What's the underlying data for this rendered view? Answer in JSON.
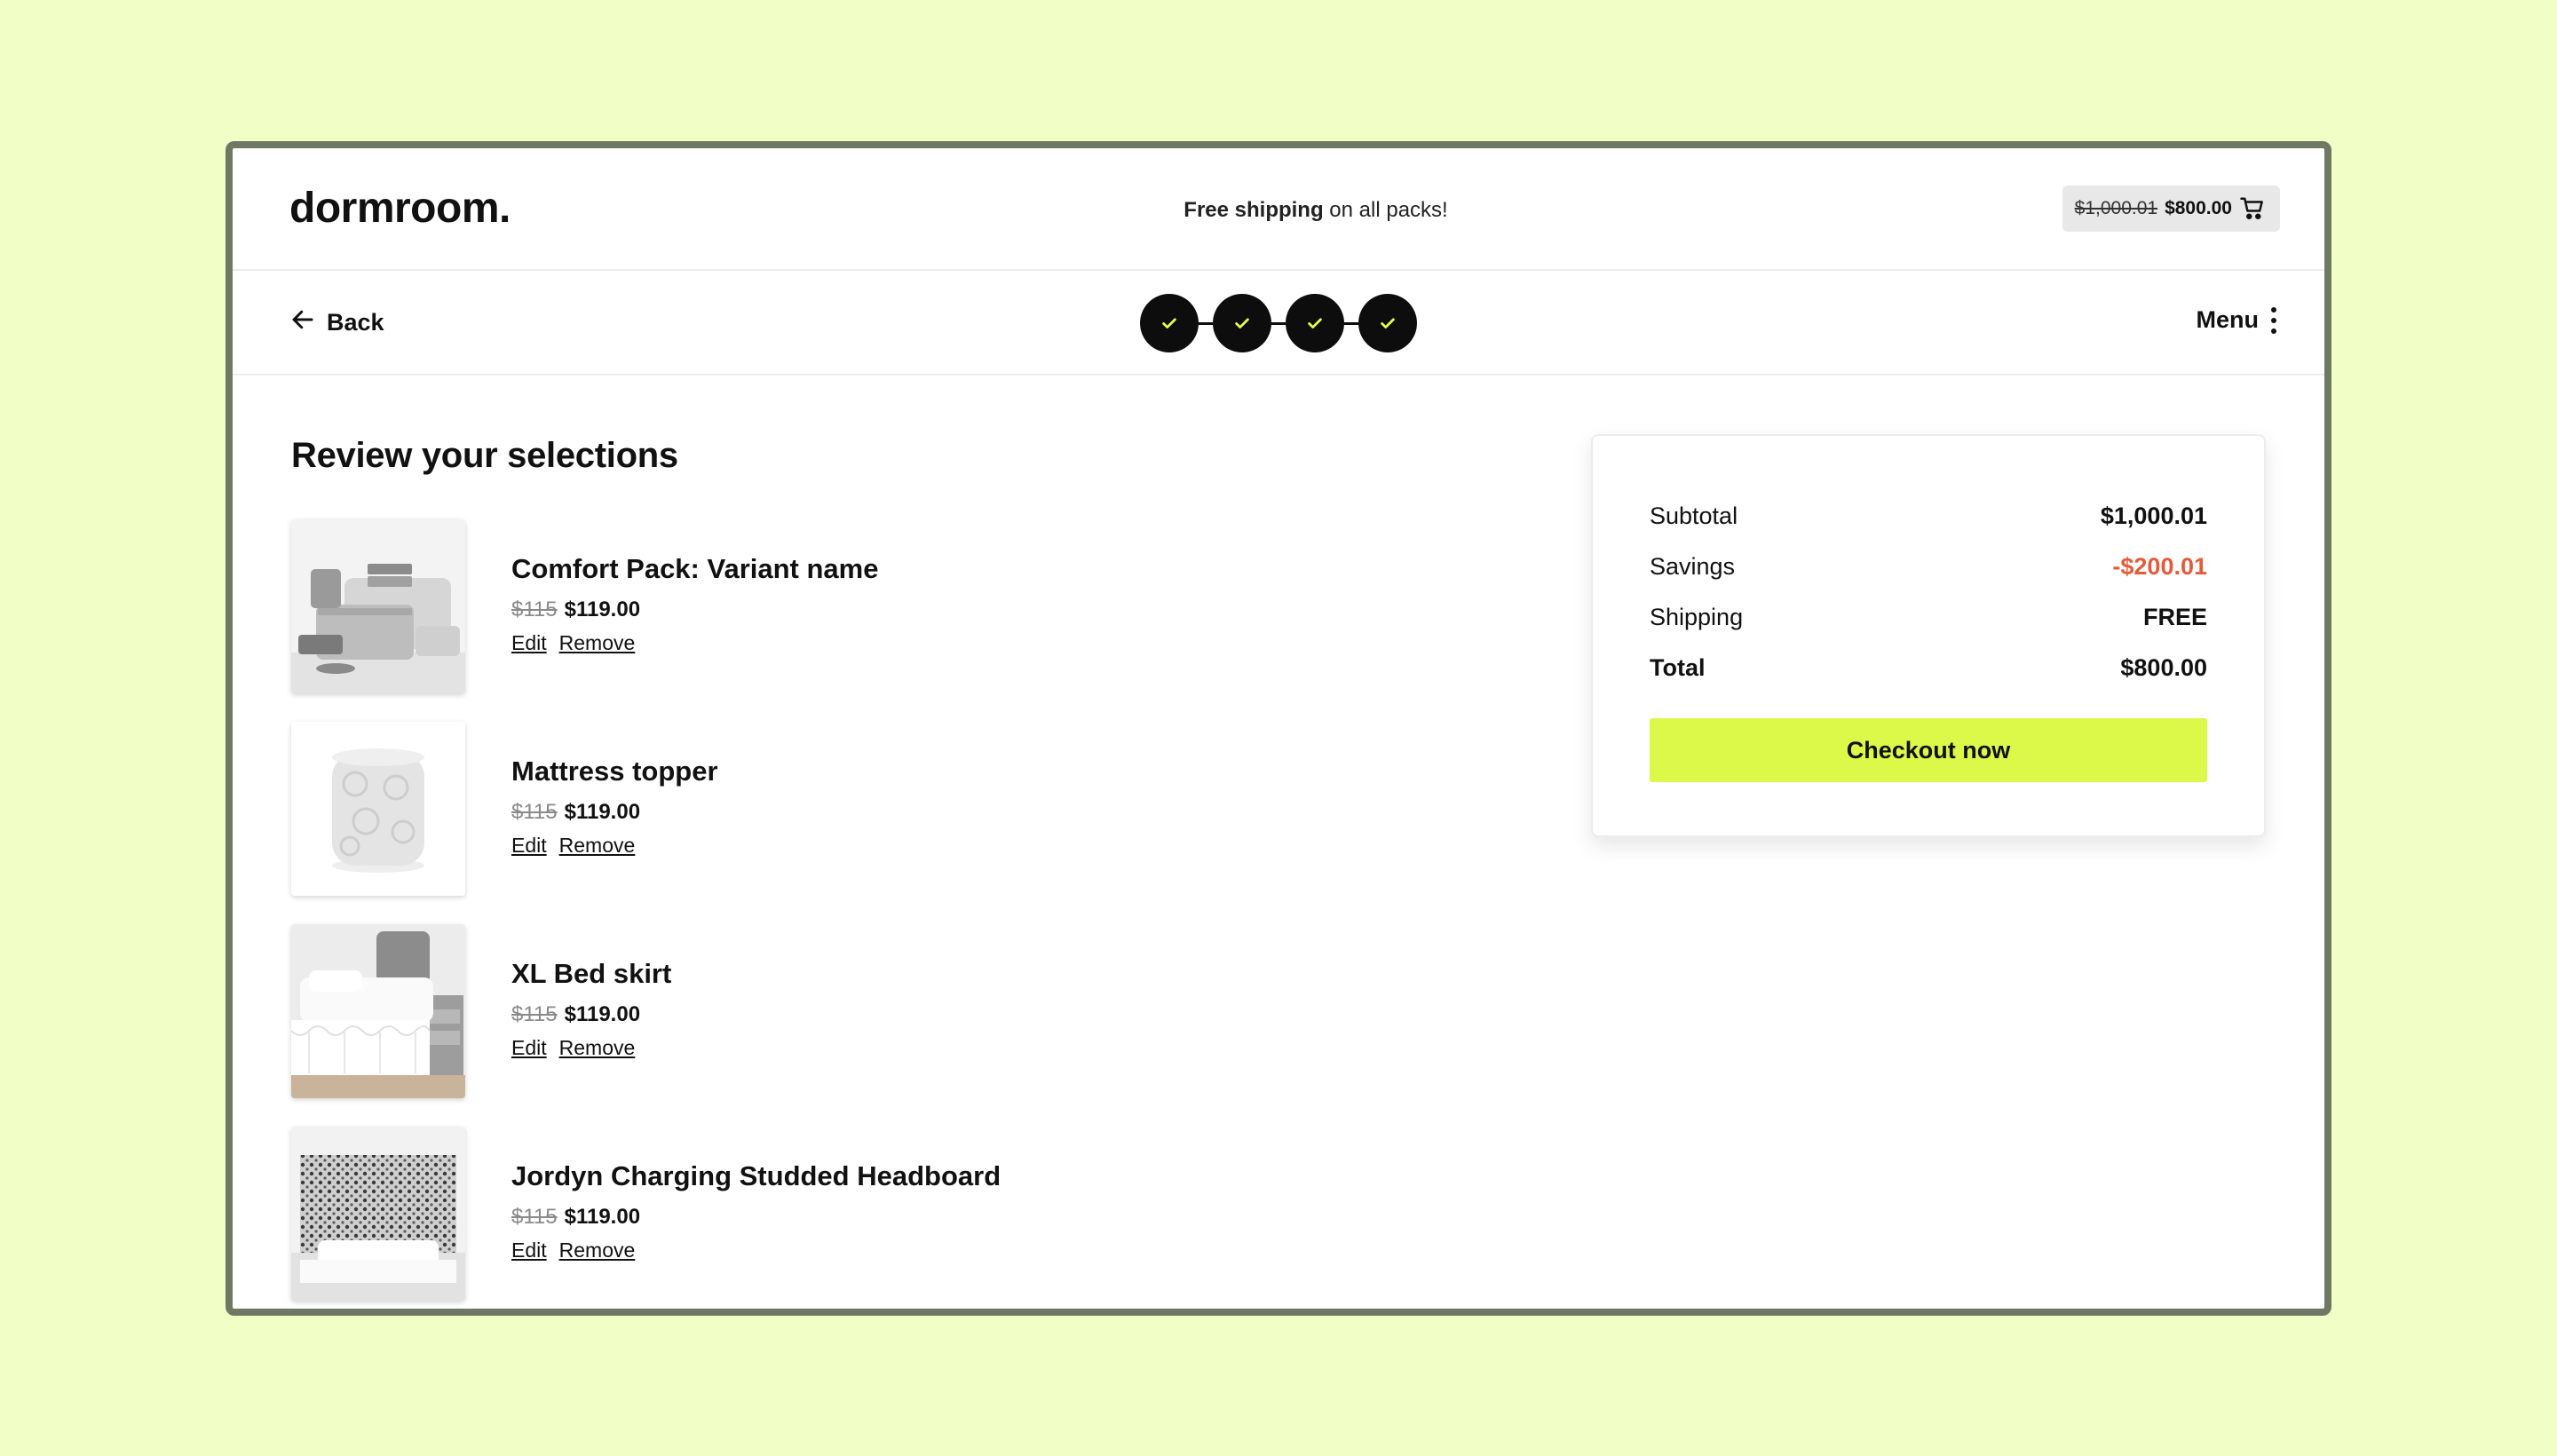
{
  "brand": {
    "logo": "dormroom."
  },
  "promo": {
    "bold": "Free shipping",
    "rest": " on all packs!"
  },
  "cart": {
    "original_total": "$1,000.01",
    "total": "$800.00",
    "icon": "cart-icon"
  },
  "nav": {
    "back_label": "Back",
    "menu_label": "Menu",
    "steps": [
      {
        "status": "complete",
        "icon": "check-icon"
      },
      {
        "status": "complete",
        "icon": "check-icon"
      },
      {
        "status": "complete",
        "icon": "check-icon"
      },
      {
        "status": "complete",
        "icon": "check-icon"
      }
    ]
  },
  "main": {
    "title": "Review your selections",
    "items": [
      {
        "name": "Comfort Pack: Variant name",
        "old_price": "$115",
        "price": "$119.00",
        "edit": "Edit",
        "remove": "Remove"
      },
      {
        "name": "Mattress topper",
        "old_price": "$115",
        "price": "$119.00",
        "edit": "Edit",
        "remove": "Remove"
      },
      {
        "name": "XL Bed skirt",
        "old_price": "$115",
        "price": "$119.00",
        "edit": "Edit",
        "remove": "Remove"
      },
      {
        "name": "Jordyn Charging Studded Headboard",
        "old_price": "$115",
        "price": "$119.00",
        "edit": "Edit",
        "remove": "Remove"
      }
    ]
  },
  "summary": {
    "subtotal_label": "Subtotal",
    "subtotal": "$1,000.01",
    "savings_label": "Savings",
    "savings": "-$200.01",
    "shipping_label": "Shipping",
    "shipping": "FREE",
    "total_label": "Total",
    "total": "$800.00",
    "checkout_label": "Checkout now"
  },
  "colors": {
    "page_background": "#f1fec6",
    "accent": "#dcf94a",
    "savings": "#e25c3b",
    "frame_border": "#6f7863"
  }
}
